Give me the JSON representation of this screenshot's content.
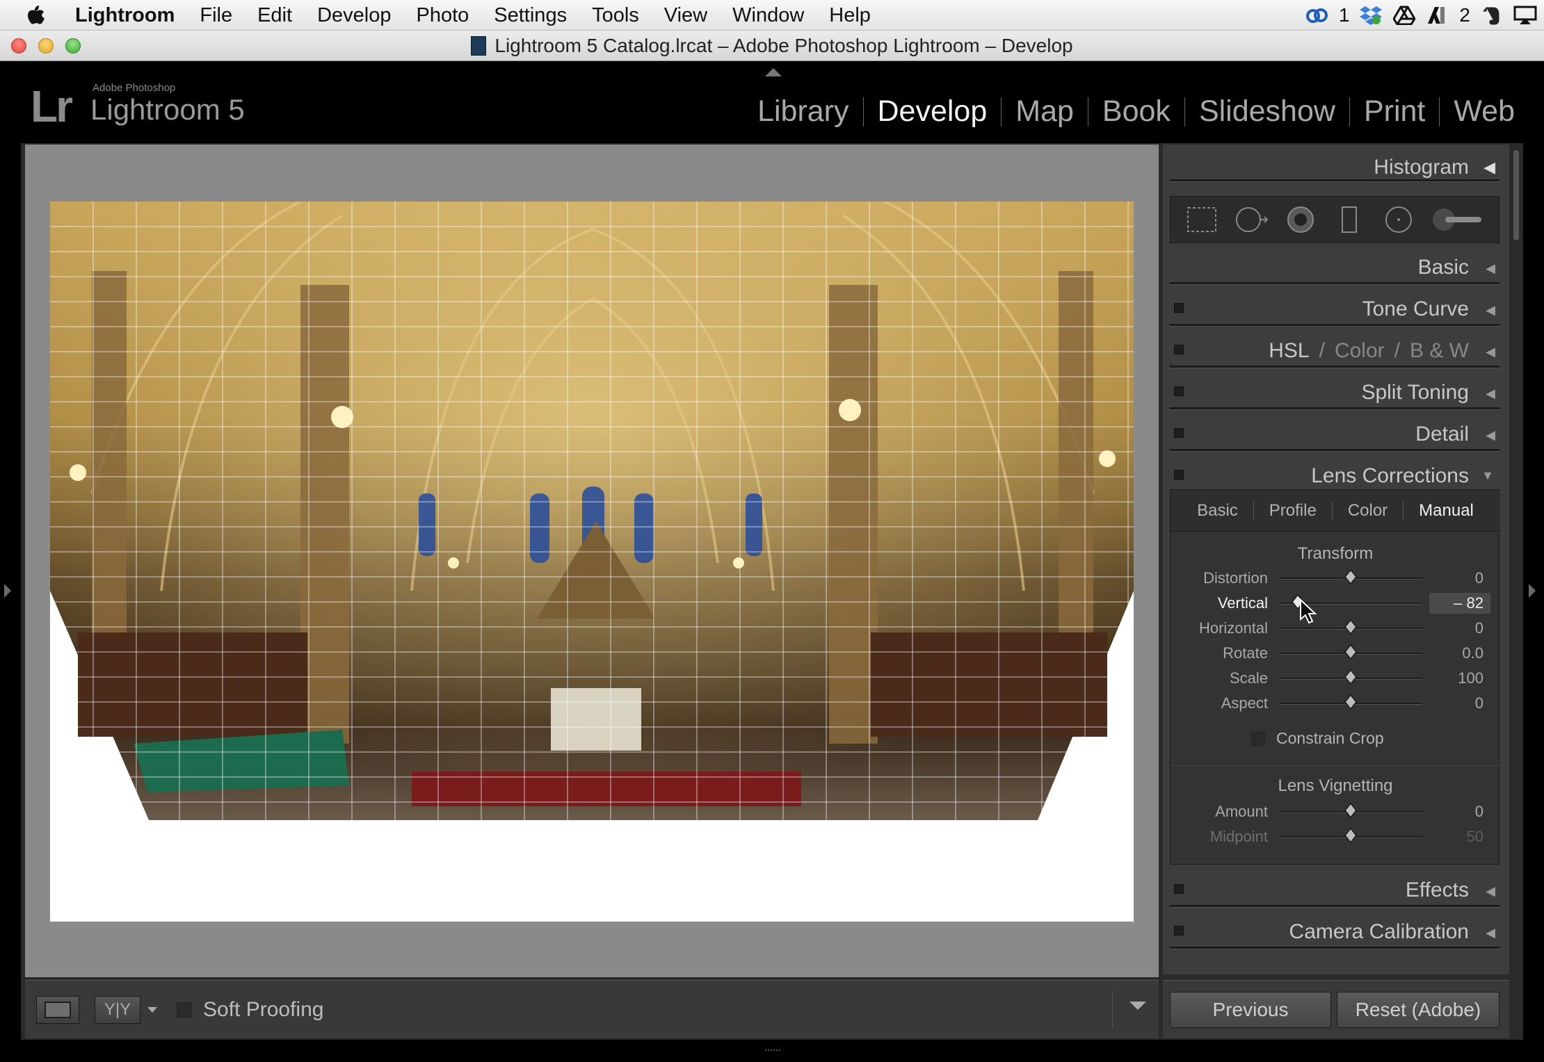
{
  "menubar": {
    "app_name": "Lightroom",
    "items": [
      "File",
      "Edit",
      "Develop",
      "Photo",
      "Settings",
      "Tools",
      "View",
      "Window",
      "Help"
    ],
    "status": {
      "cc_count": "1",
      "adobe_count": "2"
    }
  },
  "window": {
    "title": "Lightroom 5 Catalog.lrcat – Adobe Photoshop Lightroom – Develop"
  },
  "header": {
    "logo": "Lr",
    "subtitle": "Adobe Photoshop",
    "product": "Lightroom 5",
    "modules": [
      "Library",
      "Develop",
      "Map",
      "Book",
      "Slideshow",
      "Print",
      "Web"
    ],
    "active_module": "Develop"
  },
  "panels": {
    "histogram": "Histogram",
    "basic": "Basic",
    "tone_curve": "Tone Curve",
    "hsl": {
      "hsl": "HSL",
      "color": "Color",
      "bw": "B & W",
      "sep": "/"
    },
    "split_toning": "Split Toning",
    "detail": "Detail",
    "lens_corrections": "Lens Corrections",
    "effects": "Effects",
    "camera_calibration": "Camera Calibration"
  },
  "lens": {
    "tabs": [
      "Basic",
      "Profile",
      "Color",
      "Manual"
    ],
    "active_tab": "Manual",
    "transform_title": "Transform",
    "transform": [
      {
        "label": "Distortion",
        "value": "0",
        "pos": 0.5
      },
      {
        "label": "Vertical",
        "value": "– 82",
        "pos": 0.13,
        "active": true
      },
      {
        "label": "Horizontal",
        "value": "0",
        "pos": 0.5
      },
      {
        "label": "Rotate",
        "value": "0.0",
        "pos": 0.5
      },
      {
        "label": "Scale",
        "value": "100",
        "pos": 0.5
      },
      {
        "label": "Aspect",
        "value": "0",
        "pos": 0.5
      }
    ],
    "constrain_crop": "Constrain Crop",
    "vignetting_title": "Lens Vignetting",
    "vignetting": [
      {
        "label": "Amount",
        "value": "0",
        "pos": 0.5
      },
      {
        "label": "Midpoint",
        "value": "50",
        "pos": 0.5,
        "dim": true
      }
    ]
  },
  "toolbar": {
    "soft_proofing": "Soft Proofing",
    "yy": "Y|Y"
  },
  "buttons": {
    "previous": "Previous",
    "reset": "Reset (Adobe)"
  }
}
